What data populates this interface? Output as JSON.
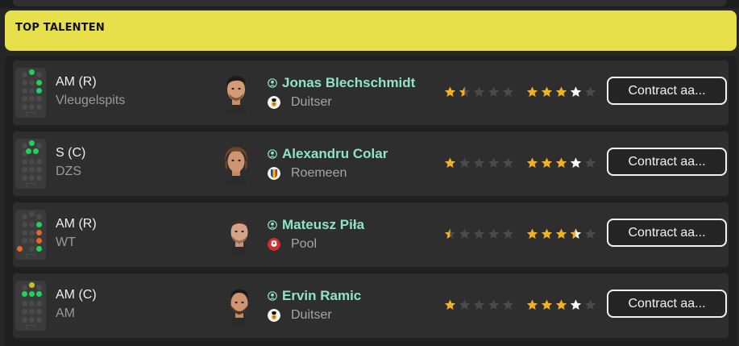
{
  "header": {
    "title": "TOP TALENTEN"
  },
  "colors": {
    "accent": "#e8e04a",
    "name": "#8fe3c7",
    "star": "#f2b21f",
    "star_current_white": "#ffffff",
    "pitch_main": "#1fd35a",
    "pitch_alt": "#e4662b",
    "pitch_natural": "#c8c21e"
  },
  "players": [
    {
      "position": "AM (R)",
      "role": "Vleugelspits",
      "name": "Jonas Blechschmidt",
      "nationality": "Duitser",
      "flag_icon": "germany-flag-icon",
      "current_ability_stars": 1.5,
      "potential_ability_stars": 4,
      "button_label": "Contract aa...",
      "pitch_positions": [
        "amr",
        "st-r",
        "mr"
      ]
    },
    {
      "position": "S (C)",
      "role": "DZS",
      "name": "Alexandru Colar",
      "nationality": "Roemeen",
      "flag_icon": "romania-flag-icon",
      "current_ability_stars": 1,
      "potential_ability_stars": 4,
      "button_label": "Contract aa...",
      "pitch_positions": [
        "st",
        "amc-l",
        "amc-r"
      ]
    },
    {
      "position": "AM (R)",
      "role": "WT",
      "name": "Mateusz Piła",
      "nationality": "Pool",
      "flag_icon": "poland-flag-icon",
      "current_ability_stars": 0.5,
      "potential_ability_stars": 3.5,
      "button_label": "Contract aa...",
      "pitch_positions": [
        "amr",
        "mr",
        "dr"
      ]
    },
    {
      "position": "AM (C)",
      "role": "AM",
      "name": "Ervin Ramic",
      "nationality": "Duitser",
      "flag_icon": "germany-flag-icon",
      "current_ability_stars": 1,
      "potential_ability_stars": 4,
      "button_label": "Contract aa...",
      "pitch_positions": [
        "st",
        "amc",
        "aml"
      ]
    }
  ]
}
